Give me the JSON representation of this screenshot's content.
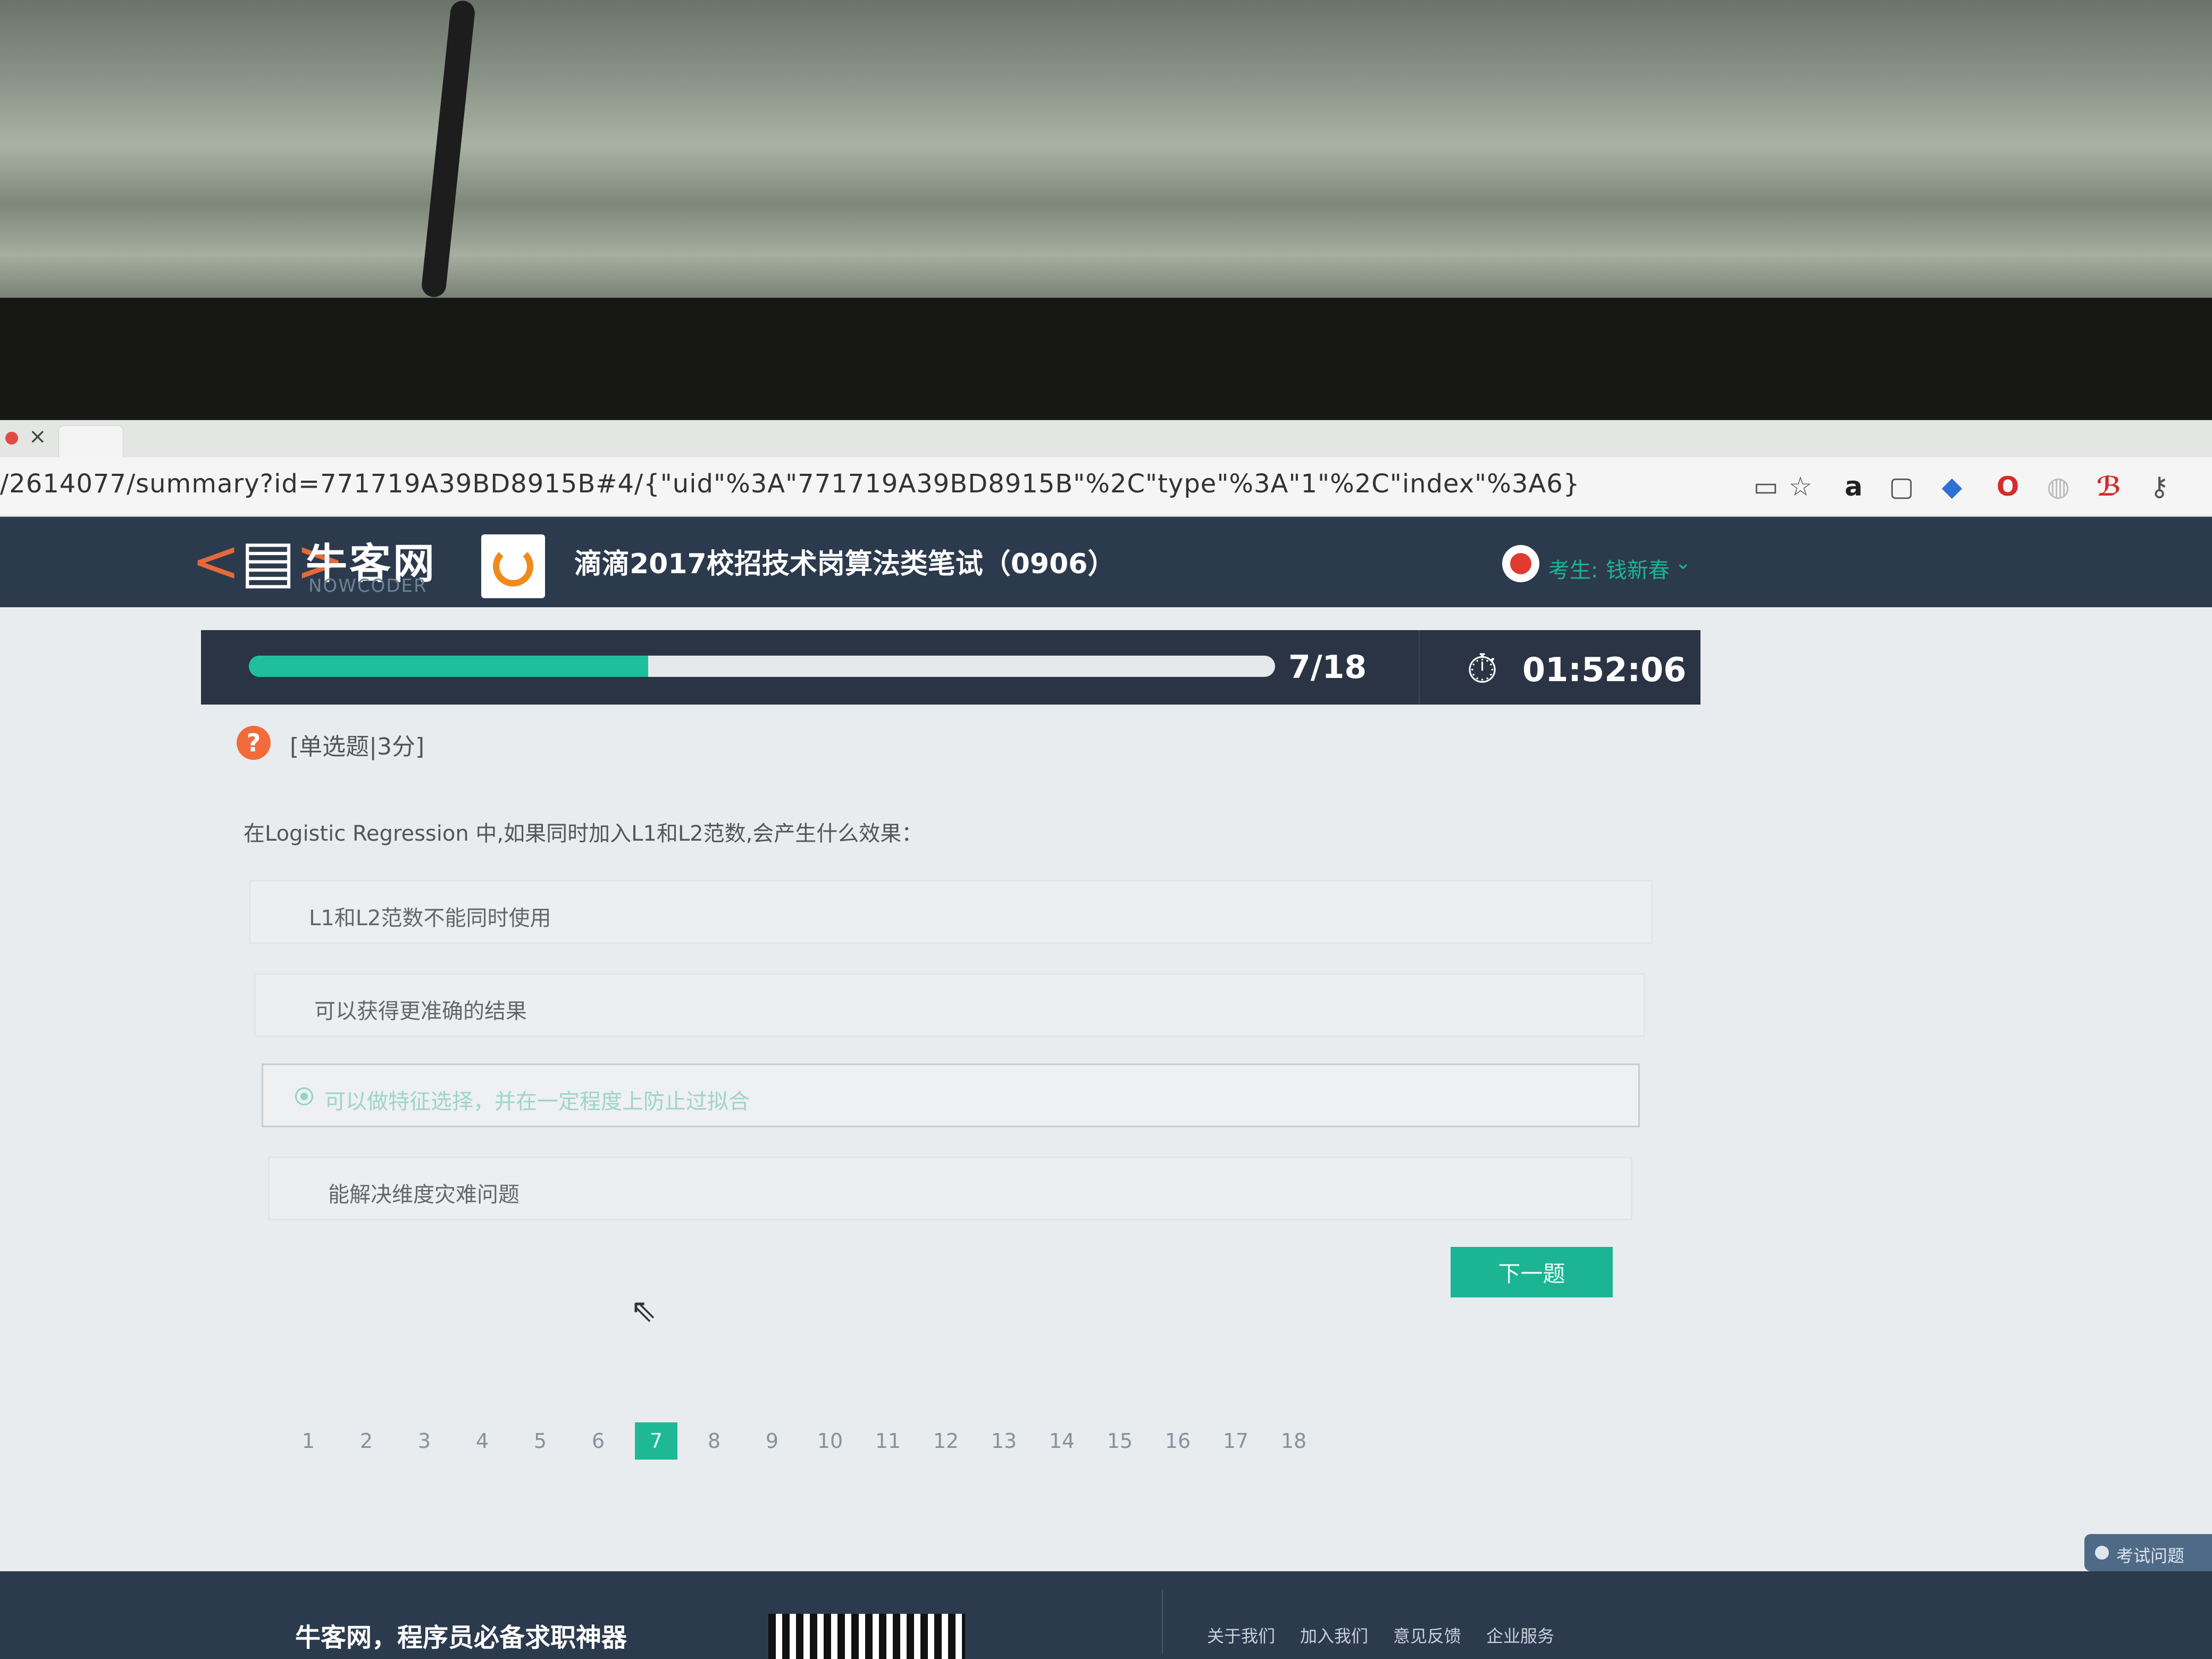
{
  "browser": {
    "url": "/2614077/summary?id=771719A39BD8915B#4/{\"uid\"%3A\"771719A39BD8915B\"%2C\"type\"%3A\"1\"%2C\"index\"%3A6}"
  },
  "header": {
    "logo_title": "牛客网",
    "logo_subtitle": "NOWCODER",
    "exam_title": "滴滴2017校招技术岗算法类笔试（0906）",
    "user_label": "考生:",
    "user_name": "钱新春"
  },
  "progress": {
    "count": "7/18",
    "fraction": 0.389,
    "timer": "01:52:06"
  },
  "question": {
    "type_label": "[单选题|3分]",
    "text": "在Logistic Regression 中,如果同时加入L1和L2范数,会产生什么效果：",
    "options": [
      {
        "label": "L1和L2范数不能同时使用",
        "selected": false
      },
      {
        "label": "可以获得更准确的结果",
        "selected": false
      },
      {
        "label": "可以做特征选择，并在一定程度上防止过拟合",
        "selected": true
      },
      {
        "label": "能解决维度灾难问题",
        "selected": false
      }
    ],
    "next_button": "下一题"
  },
  "pager": {
    "pages": [
      "1",
      "2",
      "3",
      "4",
      "5",
      "6",
      "7",
      "8",
      "9",
      "10",
      "11",
      "12",
      "13",
      "14",
      "15",
      "16",
      "17",
      "18"
    ],
    "current": "7"
  },
  "side_tab": {
    "label": "考试问题"
  },
  "footer": {
    "slogan": "牛客网，程序员必备求职神器",
    "links": [
      "关于我们",
      "加入我们",
      "意见反馈",
      "企业服务"
    ]
  },
  "colors": {
    "accent": "#1fbf9c",
    "header_bg": "#2c3a4d",
    "badge": "#f26b3a"
  }
}
